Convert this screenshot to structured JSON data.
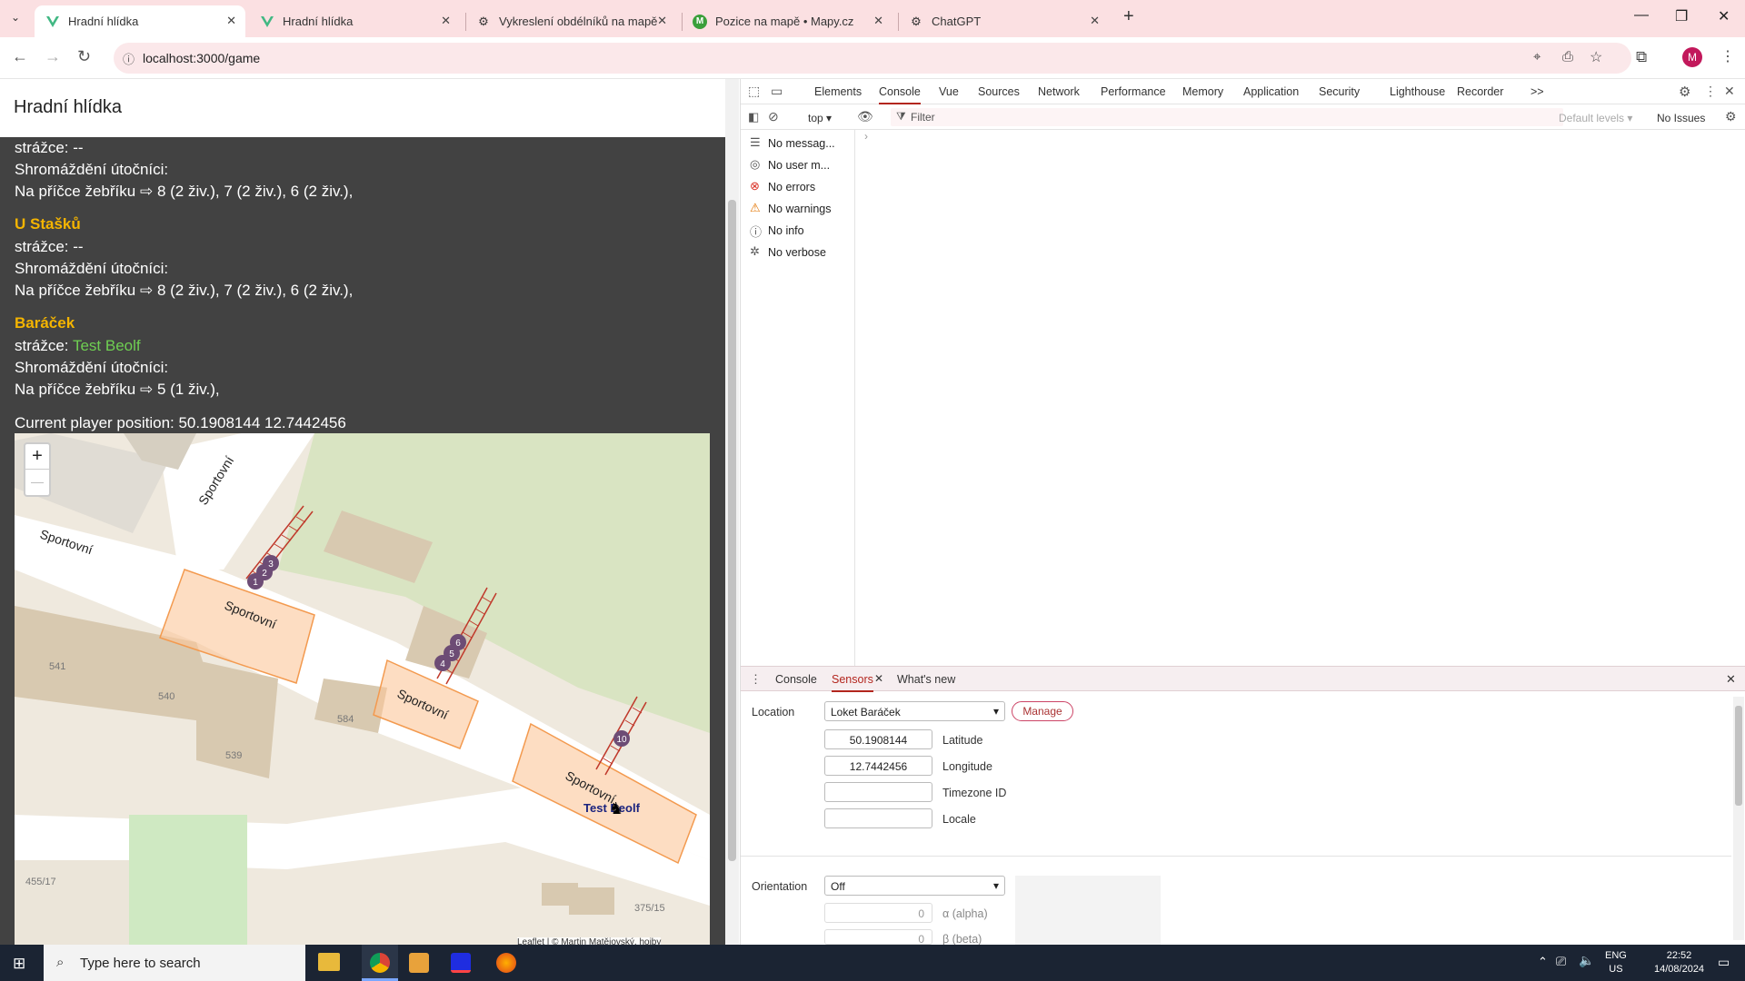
{
  "browser": {
    "tabs": [
      {
        "label": "Hradní hlídka",
        "icon": "vue-icon",
        "active": true
      },
      {
        "label": "Hradní hlídka",
        "icon": "vue-icon",
        "active": false
      },
      {
        "label": "Vykreslení obdélníků na mapě",
        "icon": "chatgpt-icon",
        "active": false
      },
      {
        "label": "Pozice na mapě • Mapy.cz",
        "icon": "mapy-icon",
        "active": false
      },
      {
        "label": "ChatGPT",
        "icon": "chatgpt-icon",
        "active": false
      }
    ],
    "url": "localhost:3000/game",
    "profile_initial": "M"
  },
  "page": {
    "title": "Hradní hlídka",
    "sections": [
      {
        "name": "",
        "guard_label": "strážce:",
        "guard_value": "--",
        "gather_label": "Shromáždění útočníci:",
        "ladder_label": "Na příčce žebříku",
        "ladder_value": "8 (2 živ.), 7 (2 živ.), 6 (2 živ.),"
      },
      {
        "name": "U Stašků",
        "guard_label": "strážce:",
        "guard_value": "--",
        "gather_label": "Shromáždění útočníci:",
        "ladder_label": "Na příčce žebříku",
        "ladder_value": "8 (2 živ.), 7 (2 živ.), 6 (2 živ.),"
      },
      {
        "name": "Baráček",
        "guard_label": "strážce:",
        "guard_value": "Test Beolf",
        "gather_label": "Shromáždění útočníci:",
        "ladder_label": "Na příčce žebříku",
        "ladder_value": "5 (1 živ.),"
      }
    ],
    "position_text": "Current player position: 50.1908144 12.7442456"
  },
  "map": {
    "zoom_in": "+",
    "zoom_out": "—",
    "street_labels": [
      "Sportovní",
      "Sportovní"
    ],
    "zone_labels": [
      "Sportovní",
      "Sportovní",
      "Sportovní"
    ],
    "house_numbers": [
      "541",
      "540",
      "584",
      "539",
      "455/17",
      "375/15"
    ],
    "markers": [
      "1",
      "2",
      "3",
      "4",
      "5",
      "6",
      "10"
    ],
    "player_name": "Test Beolf",
    "attribution": "Leaflet | © Martin Matějovský, hojby"
  },
  "devtools": {
    "tabs": [
      "Elements",
      "Console",
      "Vue",
      "Sources",
      "Network",
      "Performance",
      "Memory",
      "Application",
      "Security",
      "Lighthouse",
      "Recorder",
      ">>"
    ],
    "active_tab": "Console",
    "context": "top",
    "filter_placeholder": "Filter",
    "levels": "Default levels",
    "issues": "No Issues",
    "sidebar": [
      {
        "label": "No messag...",
        "icon": "list-icon"
      },
      {
        "label": "No user m...",
        "icon": "user-icon"
      },
      {
        "label": "No errors",
        "icon": "error-icon"
      },
      {
        "label": "No warnings",
        "icon": "warning-icon"
      },
      {
        "label": "No info",
        "icon": "info-icon"
      },
      {
        "label": "No verbose",
        "icon": "bug-icon"
      }
    ],
    "drawer_tabs": [
      "Console",
      "Sensors",
      "What's new"
    ],
    "sensors": {
      "location_label": "Location",
      "location_value": "Loket Baráček",
      "manage": "Manage",
      "latitude": "50.1908144",
      "latitude_label": "Latitude",
      "longitude": "12.7442456",
      "longitude_label": "Longitude",
      "timezone_label": "Timezone ID",
      "locale_label": "Locale",
      "orientation_label": "Orientation",
      "orientation_value": "Off",
      "alpha": "0",
      "alpha_label": "α (alpha)",
      "beta": "0",
      "beta_label": "β (beta)"
    }
  },
  "taskbar": {
    "search_placeholder": "Type here to search",
    "lang": "ENG",
    "region": "US",
    "time": "22:52",
    "date": "14/08/2024"
  }
}
